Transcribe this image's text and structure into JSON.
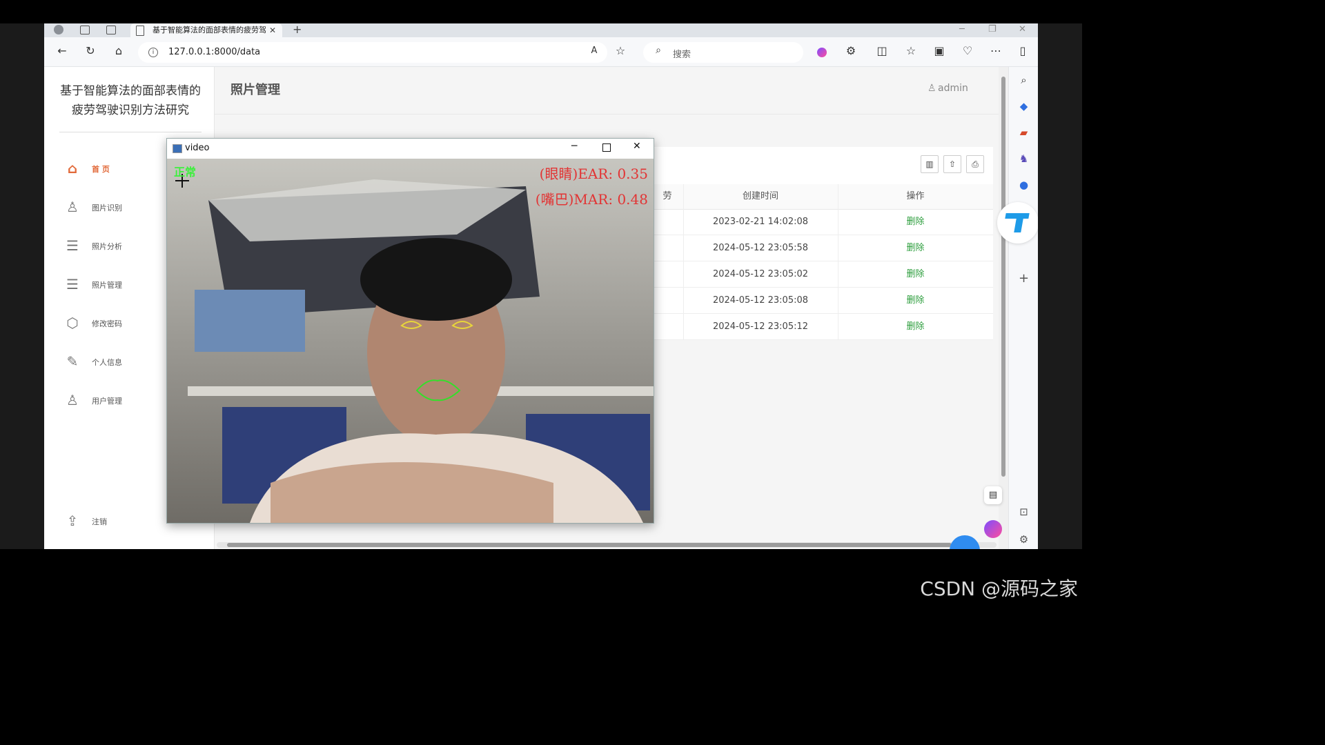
{
  "browser": {
    "tab_title": "基于智能算法的面部表情的疲劳驾",
    "address": "127.0.0.1:8000/data",
    "search_placeholder": "搜索"
  },
  "sidebar": {
    "site_title_line1": "基于智能算法的面部表情的",
    "site_title_line2": "疲劳驾驶识别方法研究",
    "items": [
      {
        "label": "首 页",
        "icon": "home-icon"
      },
      {
        "label": "图片识别",
        "icon": "user-icon"
      },
      {
        "label": "照片分析",
        "icon": "list-icon"
      },
      {
        "label": "照片管理",
        "icon": "list-icon"
      },
      {
        "label": "修改密码",
        "icon": "box-icon"
      },
      {
        "label": "个人信息",
        "icon": "pen-icon"
      },
      {
        "label": "用户管理",
        "icon": "user-icon"
      }
    ],
    "logout_label": "注销"
  },
  "header": {
    "title": "照片管理",
    "user": "admin"
  },
  "table": {
    "partial_col_header": "劳",
    "columns": [
      "创建时间",
      "操作"
    ],
    "rows": [
      {
        "created": "2023-02-21 14:02:08",
        "action": "删除"
      },
      {
        "created": "2024-05-12 23:05:58",
        "action": "删除"
      },
      {
        "created": "2024-05-12 23:05:02",
        "action": "删除"
      },
      {
        "created": "2024-05-12 23:05:08",
        "action": "删除"
      },
      {
        "created": "2024-05-12 23:05:12",
        "action": "删除"
      }
    ]
  },
  "video_window": {
    "title": "video",
    "ear_text": "(眼睛)EAR: 0.35",
    "mar_text": "(嘴巴)MAR: 0.48",
    "status_text": "正常"
  },
  "watermark": "CSDN @源码之家",
  "colors": {
    "accent": "#e26a3a",
    "delete_link": "#2e9e3e",
    "overlay_red": "#e23434",
    "overlay_green": "#3df03d"
  }
}
